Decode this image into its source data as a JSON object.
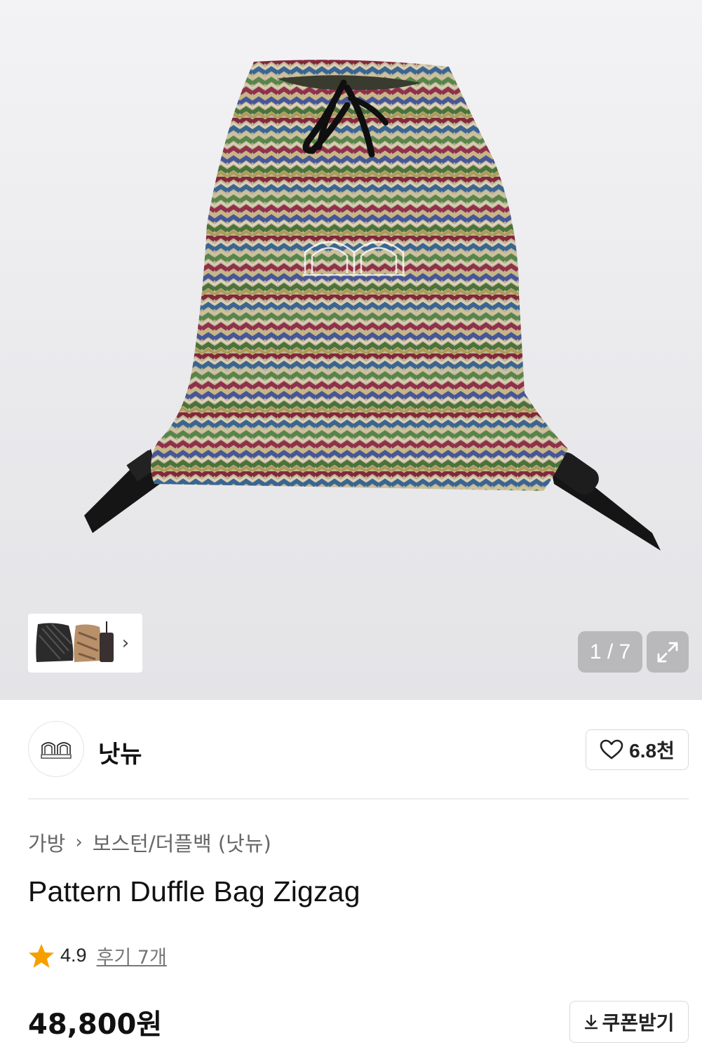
{
  "gallery": {
    "counter": "1 / 7",
    "thumbnail_more_icon": "chevron-right-icon",
    "expand_icon": "expand-icon"
  },
  "store": {
    "name": "낫뉴",
    "likes": "6.8천",
    "like_icon": "heart-icon"
  },
  "breadcrumb": {
    "items": [
      "가방",
      "보스턴/더플백 (낫뉴)"
    ]
  },
  "product": {
    "title": "Pattern Duffle Bag Zigzag",
    "rating": "4.9",
    "reviews": "후기 7개",
    "price": "48,800원",
    "coupon_label": "쿠폰받기"
  },
  "colors": {
    "star": "#f5a000",
    "text": "#111111",
    "muted": "#666666",
    "border": "#d9d9d9"
  }
}
